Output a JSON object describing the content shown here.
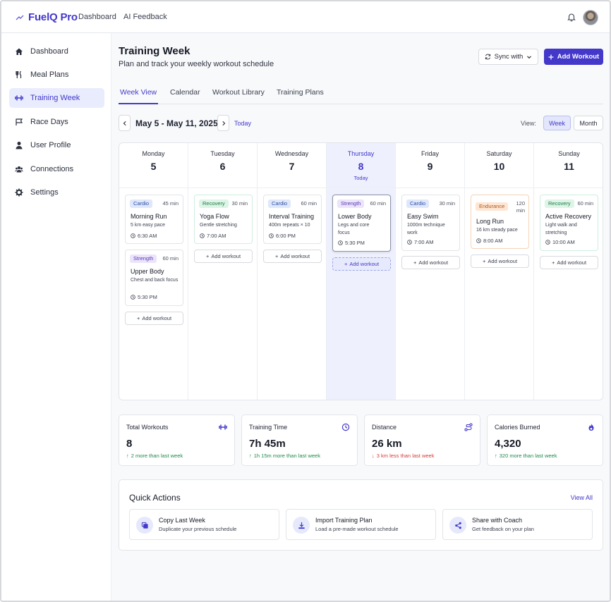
{
  "app": {
    "logo_text": "FuelQ Pro",
    "nav_links": [
      "Dashboard",
      "AI Feedback"
    ]
  },
  "sidebar": {
    "items": [
      {
        "label": "Dashboard",
        "icon": "home-icon",
        "active": false
      },
      {
        "label": "Meal Plans",
        "icon": "utensils-icon",
        "active": false
      },
      {
        "label": "Training Week",
        "icon": "dumbbell-icon",
        "active": true
      },
      {
        "label": "Race Days",
        "icon": "flag-icon",
        "active": false
      },
      {
        "label": "User Profile",
        "icon": "user-icon",
        "active": false
      },
      {
        "label": "Connections",
        "icon": "users-icon",
        "active": false
      },
      {
        "label": "Settings",
        "icon": "gear-icon",
        "active": false
      }
    ]
  },
  "page": {
    "title": "Training Week",
    "subtitle": "Plan and track your weekly workout schedule",
    "sync_label": "Sync with",
    "add_workout_label": "Add Workout"
  },
  "tabs": [
    "Week View",
    "Calendar",
    "Workout Library",
    "Training Plans"
  ],
  "week_nav": {
    "range": "May 5 - May 11, 2025",
    "today": "Today",
    "view_label": "View:",
    "views": [
      "Week",
      "Month"
    ]
  },
  "add_workout_text": "Add workout",
  "days": [
    {
      "name": "Monday",
      "num": "5",
      "workouts": [
        {
          "type": "Cardio",
          "duration": "45 min",
          "name": "Morning Run",
          "desc": "5 km easy pace",
          "time": "6:30 AM"
        },
        {
          "type": "Strength",
          "duration": "60 min",
          "name": "Upper Body",
          "desc": "Chest and back focus",
          "time": "5:30 PM"
        }
      ]
    },
    {
      "name": "Tuesday",
      "num": "6",
      "workouts": [
        {
          "type": "Recovery",
          "duration": "30 min",
          "name": "Yoga Flow",
          "desc": "Gentle stretching",
          "time": "7:00 AM"
        }
      ]
    },
    {
      "name": "Wednesday",
      "num": "7",
      "workouts": [
        {
          "type": "Cardio",
          "duration": "60 min",
          "name": "Interval Training",
          "desc": "400m repeats × 10",
          "time": "6:00 PM"
        }
      ]
    },
    {
      "name": "Thursday",
      "num": "8",
      "today_label": "Today",
      "workouts": [
        {
          "type": "Strength",
          "duration": "60 min",
          "name": "Lower Body",
          "desc": "Legs and core focus",
          "time": "5:30 PM"
        }
      ]
    },
    {
      "name": "Friday",
      "num": "9",
      "workouts": [
        {
          "type": "Cardio",
          "duration": "30 min",
          "name": "Easy Swim",
          "desc": "1000m technique work",
          "time": "7:00 AM"
        }
      ]
    },
    {
      "name": "Saturday",
      "num": "10",
      "workouts": [
        {
          "type": "Endurance",
          "duration": "120 min",
          "name": "Long Run",
          "desc": "16 km steady pace",
          "time": "8:00 AM"
        }
      ]
    },
    {
      "name": "Sunday",
      "num": "11",
      "workouts": [
        {
          "type": "Recovery",
          "duration": "60 min",
          "name": "Active Recovery",
          "desc": "Light walk and stretching",
          "time": "10:00 AM"
        }
      ]
    }
  ],
  "stats": [
    {
      "label": "Total Workouts",
      "value": "8",
      "change": "2 more than last week",
      "trend": "up",
      "icon": "dumbbell-icon"
    },
    {
      "label": "Training Time",
      "value": "7h 45m",
      "change": "1h 15m more than last week",
      "trend": "up",
      "icon": "clock-icon"
    },
    {
      "label": "Distance",
      "value": "26 km",
      "change": "3 km less than last week",
      "trend": "down",
      "icon": "route-icon"
    },
    {
      "label": "Calories Burned",
      "value": "4,320",
      "change": "320 more than last week",
      "trend": "up",
      "icon": "flame-icon"
    }
  ],
  "quick_actions": {
    "title": "Quick Actions",
    "view_all": "View All",
    "items": [
      {
        "name": "Copy Last Week",
        "desc": "Duplicate your previous schedule",
        "icon": "copy-icon"
      },
      {
        "name": "Import Training Plan",
        "desc": "Load a pre-made workout schedule",
        "icon": "download-icon"
      },
      {
        "name": "Share with Coach",
        "desc": "Get feedback on your plan",
        "icon": "share-icon"
      }
    ]
  },
  "colors": {
    "accent": "#4338ca",
    "today_column": "#eef0fd",
    "up": "#1e8a4c",
    "down": "#d63b3b"
  }
}
